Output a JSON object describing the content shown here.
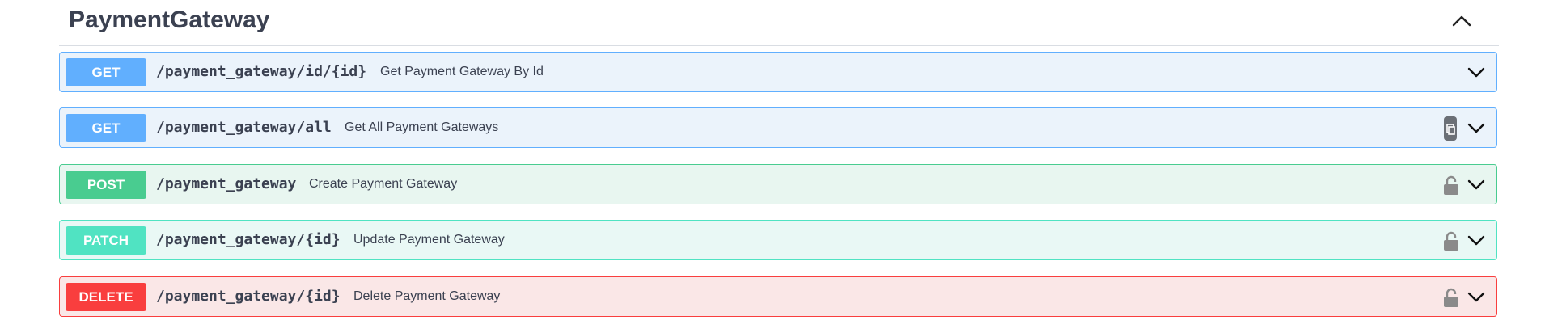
{
  "section": {
    "title": "PaymentGateway",
    "collapse_icon": "chevron-up-icon"
  },
  "operations": [
    {
      "method": "GET",
      "path": "/payment_gateway/id/{id}",
      "description": "Get Payment Gateway By Id",
      "color": "#61affe"
    },
    {
      "method": "GET",
      "path": "/payment_gateway/all",
      "description": "Get All Payment Gateways",
      "color": "#61affe",
      "icon": "copy-icon"
    },
    {
      "method": "POST",
      "path": "/payment_gateway",
      "description": "Create Payment Gateway",
      "color": "#49cc90",
      "icon": "unlocked-icon"
    },
    {
      "method": "PATCH",
      "path": "/payment_gateway/{id}",
      "description": "Update Payment Gateway",
      "color": "#50e3c2",
      "icon": "unlocked-icon"
    },
    {
      "method": "DELETE",
      "path": "/payment_gateway/{id}",
      "description": "Delete Payment Gateway",
      "color": "#f93e3e",
      "icon": "unlocked-icon"
    }
  ]
}
